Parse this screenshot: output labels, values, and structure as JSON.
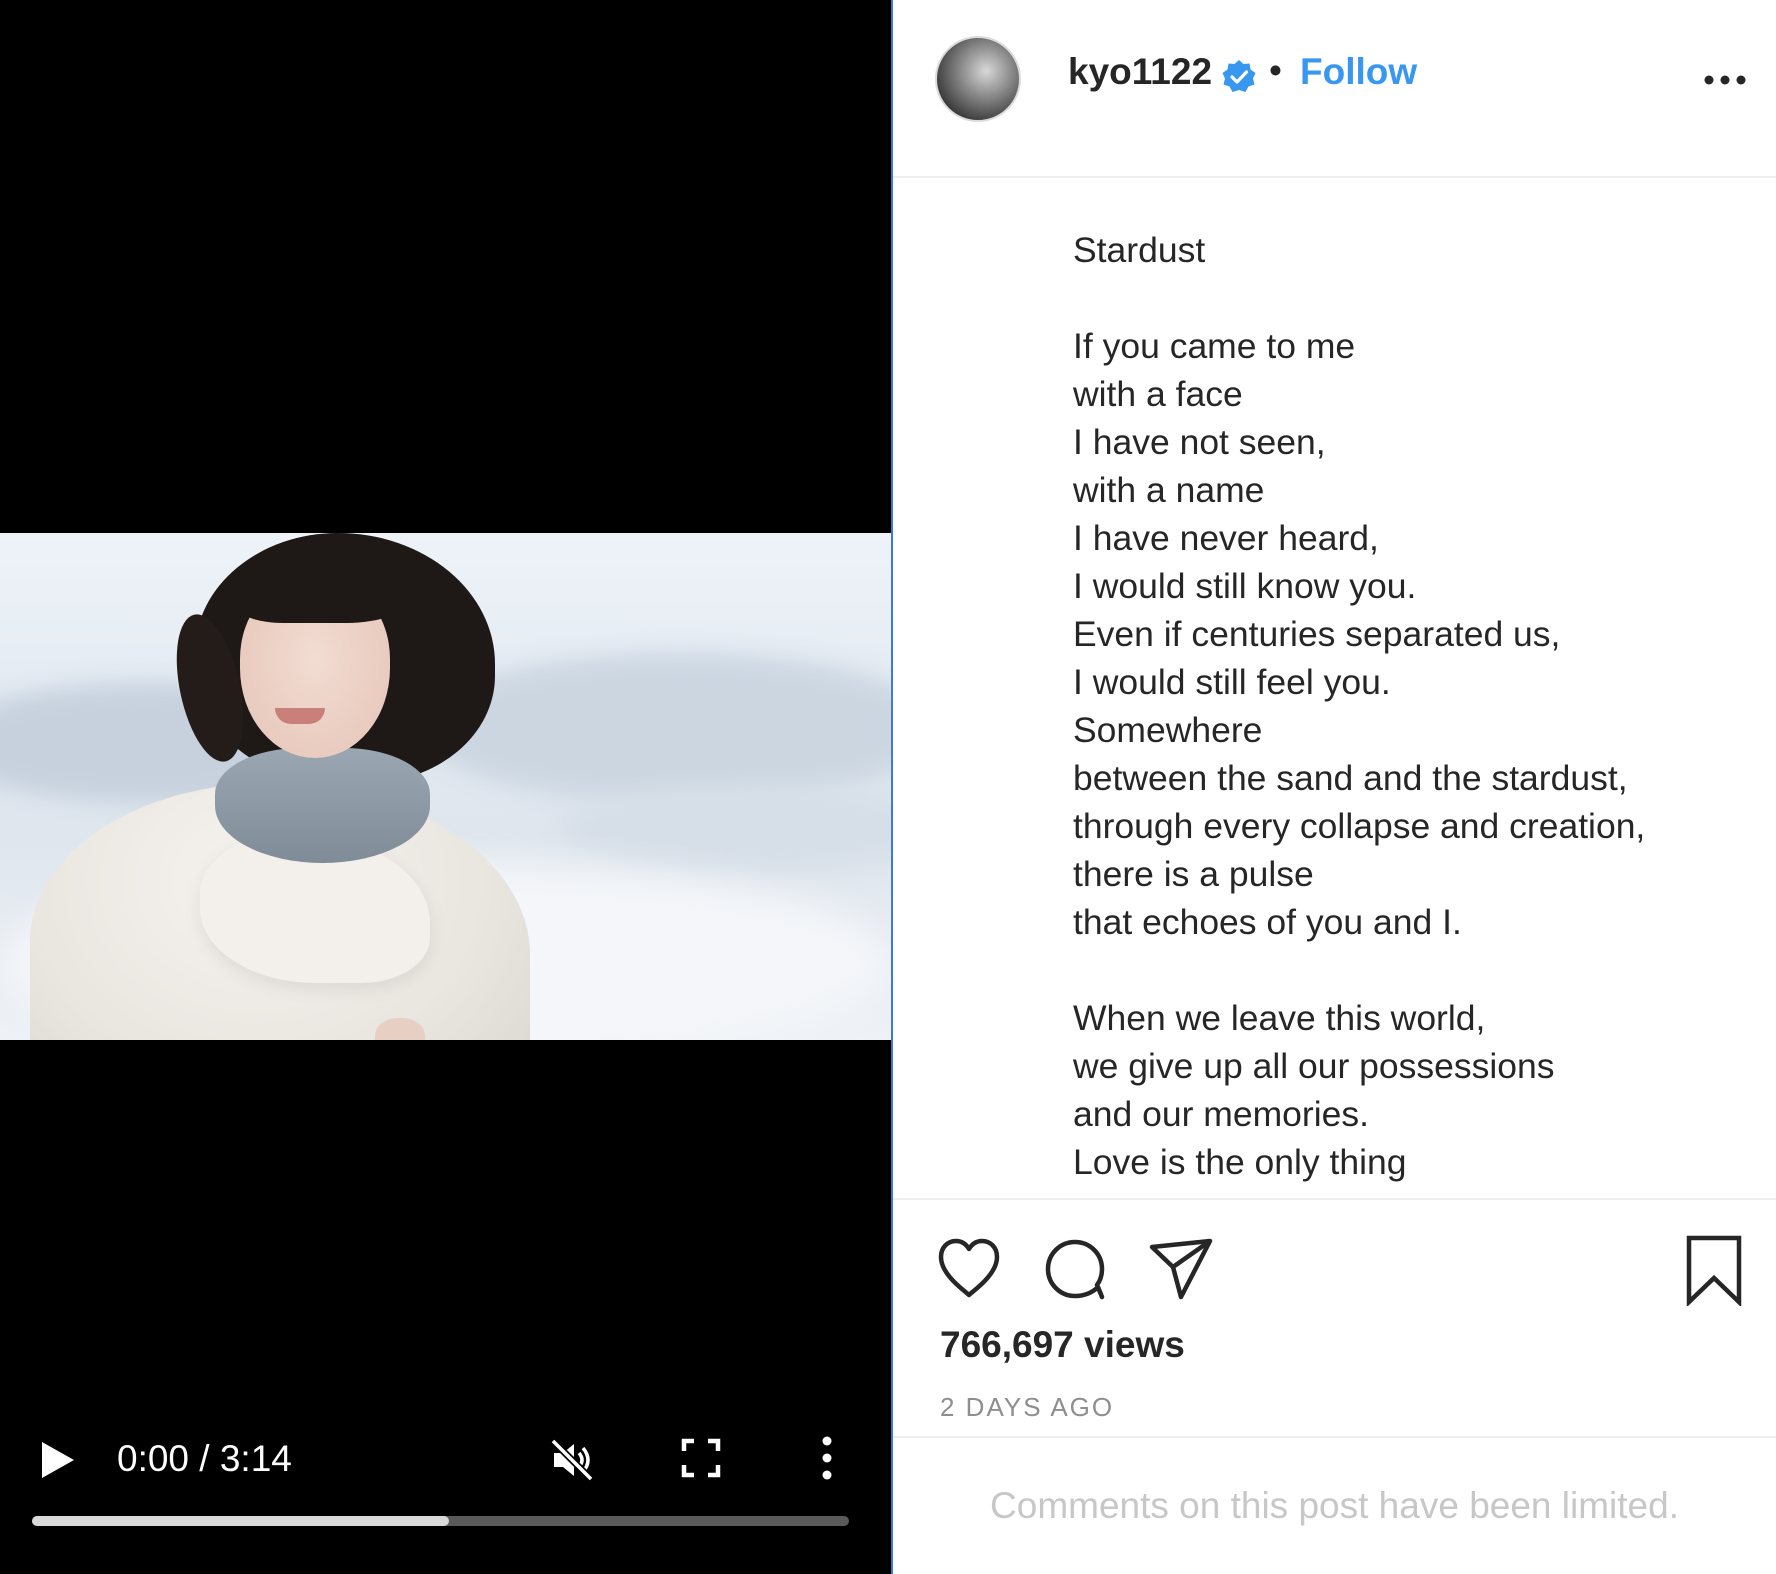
{
  "video": {
    "current_time": "0:00",
    "separator": " / ",
    "duration": "3:14",
    "progress_buffered": 0.51,
    "muted": true,
    "icons": {
      "play": "play-icon",
      "mute": "muted-speaker-icon",
      "fullscreen": "fullscreen-icon",
      "more": "vertical-dots-icon"
    }
  },
  "header": {
    "username": "kyo1122",
    "verified": true,
    "dot": "•",
    "follow_label": "Follow",
    "options_icon": "horizontal-dots-icon"
  },
  "caption": {
    "lines": [
      "Stardust",
      "",
      "If you came to me",
      "with a face",
      "I have not seen,",
      "with a name",
      "I have never heard,",
      "I would still know you.",
      "Even if centuries separated us,",
      "I would still feel you.",
      "Somewhere",
      "between the sand and the stardust,",
      "through every collapse and creation,",
      "there is a pulse",
      "that echoes of you and I.",
      "",
      "When we leave this world,",
      "we give up all our possessions",
      "and our memories.",
      "Love is the only thing"
    ]
  },
  "actions": {
    "views": "766,697 views",
    "time_ago": "2 DAYS AGO"
  },
  "comments": {
    "notice": "Comments on this post have been limited."
  },
  "colors": {
    "accent": "#3897f0",
    "divider": "#3b7bd6",
    "muted_text": "#8e8e8e",
    "disabled_text": "#c7c7c7"
  }
}
